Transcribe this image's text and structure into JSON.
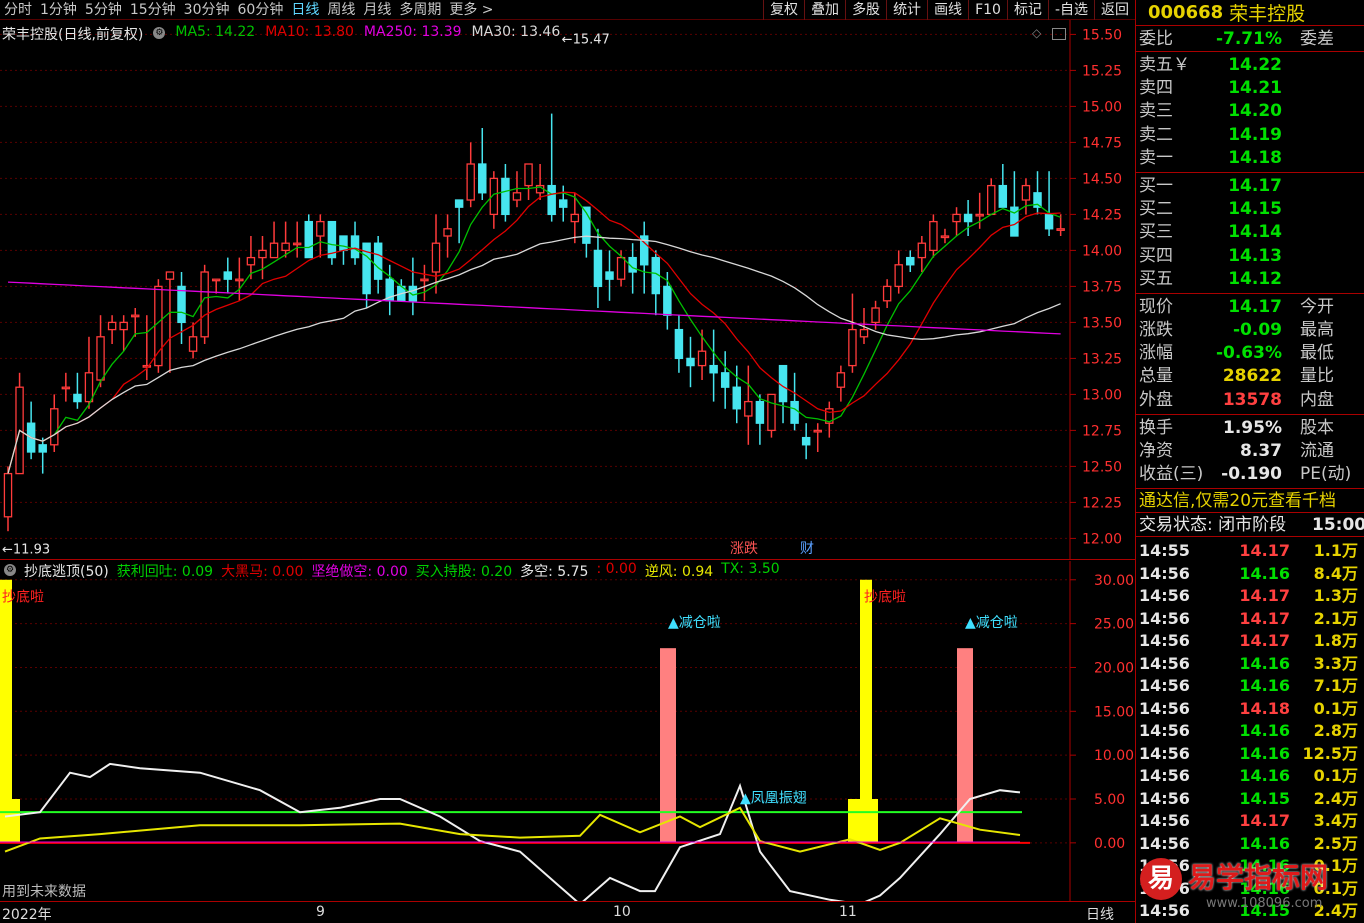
{
  "toolbar": {
    "periods": [
      "分时",
      "1分钟",
      "5分钟",
      "15分钟",
      "30分钟",
      "60分钟",
      "日线",
      "周线",
      "月线",
      "多周期",
      "更多 >"
    ],
    "active_period": "日线",
    "buttons": [
      "复权",
      "叠加",
      "多股",
      "统计",
      "画线",
      "F10",
      "标记",
      "-自选",
      "返回"
    ]
  },
  "main": {
    "title": "荣丰控股(日线,前复权)",
    "ma": [
      {
        "label": "MA5: 14.22",
        "color": "#00c000"
      },
      {
        "label": "MA10: 13.80",
        "color": "#e00000"
      },
      {
        "label": "MA250: 13.39",
        "color": "#e000e0"
      },
      {
        "label": "MA30: 13.46",
        "color": "#d8d8d8"
      }
    ],
    "high_label": "15.47",
    "low_label": "11.93",
    "tag_zhangdie": "涨跌",
    "tag_cai": "财"
  },
  "indicator": {
    "name": "抄底逃顶(50)",
    "items": [
      {
        "label": "获利回吐: 0.09",
        "color": "#00d000"
      },
      {
        "label": "大黑马: 0.00",
        "color": "#e00000"
      },
      {
        "label": "坚绝做空: 0.00",
        "color": "#e000e0"
      },
      {
        "label": "买入持股: 0.20",
        "color": "#00d000"
      },
      {
        "label": "多空: 5.75",
        "color": "#e6e6e6"
      },
      {
        "label": ": 0.00",
        "color": "#e00000"
      },
      {
        "label": "逆风: 0.94",
        "color": "#e6e600"
      },
      {
        "label": "TX: 3.50",
        "color": "#00d000"
      }
    ],
    "signal_buy": "抄底啦",
    "signal_sell": "▲减仓啦",
    "signal_phoenix": "▲凤凰振翅",
    "future_note": "用到未来数据"
  },
  "bottom": {
    "year_label": "2022年",
    "months": [
      "9",
      "10",
      "11"
    ],
    "period_label": "日线"
  },
  "quote": {
    "code": "000668",
    "name": "荣丰控股",
    "weibi_label": "委比",
    "weibi_value": "-7.71%",
    "weicha_label": "委差",
    "asks": [
      {
        "label": "卖五￥",
        "price": "14.22"
      },
      {
        "label": "卖四",
        "price": "14.21"
      },
      {
        "label": "卖三",
        "price": "14.20"
      },
      {
        "label": "卖二",
        "price": "14.19"
      },
      {
        "label": "卖一",
        "price": "14.18"
      }
    ],
    "bids": [
      {
        "label": "买一",
        "price": "14.17"
      },
      {
        "label": "买二",
        "price": "14.15"
      },
      {
        "label": "买三",
        "price": "14.14"
      },
      {
        "label": "买四",
        "price": "14.13"
      },
      {
        "label": "买五",
        "price": "14.12"
      }
    ],
    "stats": [
      {
        "label": "现价",
        "value": "14.17",
        "color": "#00e000",
        "label2": "今开"
      },
      {
        "label": "涨跌",
        "value": "-0.09",
        "color": "#00e000",
        "label2": "最高"
      },
      {
        "label": "涨幅",
        "value": "-0.63%",
        "color": "#00e000",
        "label2": "最低"
      },
      {
        "label": "总量",
        "value": "28622",
        "color": "#e6d200",
        "label2": "量比"
      },
      {
        "label": "外盘",
        "value": "13578",
        "color": "#ff4040",
        "label2": "内盘"
      }
    ],
    "stats2": [
      {
        "label": "换手",
        "value": "1.95%",
        "color": "#e6e6e6",
        "label2": "股本"
      },
      {
        "label": "净资",
        "value": "8.37",
        "color": "#e6e6e6",
        "label2": "流通"
      },
      {
        "label": "收益(三)",
        "value": "-0.190",
        "color": "#e6e6e6",
        "label2": "PE(动)"
      }
    ],
    "ad": "通达信,仅需20元查看千档",
    "trade_state": "交易状态: 闭市阶段",
    "trade_time": "15:00:",
    "ticks": [
      {
        "t": "14:55",
        "p": "14.17",
        "v": "1.1万"
      },
      {
        "t": "14:56",
        "p": "14.16",
        "v": "8.4万"
      },
      {
        "t": "14:56",
        "p": "14.17",
        "v": "1.3万"
      },
      {
        "t": "14:56",
        "p": "14.17",
        "v": "2.1万"
      },
      {
        "t": "14:56",
        "p": "14.17",
        "v": "1.8万"
      },
      {
        "t": "14:56",
        "p": "14.16",
        "v": "3.3万"
      },
      {
        "t": "14:56",
        "p": "14.16",
        "v": "7.1万"
      },
      {
        "t": "14:56",
        "p": "14.18",
        "v": "0.1万"
      },
      {
        "t": "14:56",
        "p": "14.16",
        "v": "2.8万"
      },
      {
        "t": "14:56",
        "p": "14.16",
        "v": "12.5万"
      },
      {
        "t": "14:56",
        "p": "14.16",
        "v": "0.1万"
      },
      {
        "t": "14:56",
        "p": "14.15",
        "v": "2.4万"
      },
      {
        "t": "14:56",
        "p": "14.17",
        "v": "3.4万"
      },
      {
        "t": "14:56",
        "p": "14.16",
        "v": "2.5万"
      },
      {
        "t": "14:56",
        "p": "14.16",
        "v": "0.1万"
      },
      {
        "t": "14:56",
        "p": "14.16",
        "v": "0.1万"
      },
      {
        "t": "14:56",
        "p": "14.15",
        "v": "2.4万"
      }
    ],
    "watermark": "易学指标网",
    "watermark_logo": "易",
    "watermark_url": "www.108096.com"
  },
  "chart_data": [
    {
      "type": "candlestick",
      "title": "荣丰控股(日线,前复权)",
      "ylim": [
        11.85,
        15.6
      ],
      "yticks": [
        12.0,
        12.25,
        12.5,
        12.75,
        13.0,
        13.25,
        13.5,
        13.75,
        14.0,
        14.25,
        14.5,
        14.75,
        15.0,
        15.25,
        15.5
      ],
      "ohlc": [
        [
          12.15,
          12.45,
          12.05,
          12.5
        ],
        [
          12.45,
          13.05,
          12.45,
          13.15
        ],
        [
          12.8,
          12.6,
          12.55,
          12.95
        ],
        [
          12.65,
          12.6,
          12.45,
          12.7
        ],
        [
          12.65,
          12.9,
          12.6,
          13.0
        ],
        [
          13.05,
          13.05,
          12.95,
          13.15
        ],
        [
          13.0,
          12.95,
          12.9,
          13.15
        ],
        [
          12.95,
          13.15,
          12.9,
          13.4
        ],
        [
          13.1,
          13.4,
          13.05,
          13.55
        ],
        [
          13.45,
          13.5,
          13.35,
          13.55
        ],
        [
          13.45,
          13.5,
          13.3,
          13.55
        ],
        [
          13.55,
          13.55,
          13.4,
          13.6
        ],
        [
          13.2,
          13.2,
          13.1,
          13.55
        ],
        [
          13.2,
          13.75,
          13.15,
          13.8
        ],
        [
          13.8,
          13.85,
          13.15,
          13.85
        ],
        [
          13.75,
          13.5,
          13.35,
          13.85
        ],
        [
          13.3,
          13.4,
          13.25,
          13.5
        ],
        [
          13.4,
          13.85,
          13.35,
          13.9
        ],
        [
          13.8,
          13.8,
          13.7,
          13.8
        ],
        [
          13.85,
          13.8,
          13.7,
          13.95
        ],
        [
          13.8,
          13.8,
          13.65,
          13.95
        ],
        [
          13.9,
          13.95,
          13.8,
          14.1
        ],
        [
          13.95,
          14.0,
          13.8,
          14.1
        ],
        [
          13.95,
          14.05,
          13.95,
          14.2
        ],
        [
          14.0,
          14.05,
          13.95,
          14.2
        ],
        [
          14.05,
          14.05,
          13.95,
          14.2
        ],
        [
          14.2,
          13.95,
          13.95,
          14.25
        ],
        [
          14.1,
          14.2,
          13.95,
          14.25
        ],
        [
          14.2,
          13.95,
          13.9,
          14.2
        ],
        [
          14.1,
          14.0,
          13.9,
          14.1
        ],
        [
          14.1,
          13.95,
          13.9,
          14.2
        ],
        [
          14.05,
          13.7,
          13.6,
          14.05
        ],
        [
          14.05,
          13.8,
          13.7,
          14.1
        ],
        [
          13.8,
          13.65,
          13.55,
          13.9
        ],
        [
          13.75,
          13.65,
          13.65,
          13.8
        ],
        [
          13.75,
          13.65,
          13.55,
          13.95
        ],
        [
          13.8,
          13.8,
          13.65,
          13.9
        ],
        [
          13.85,
          14.05,
          13.7,
          14.25
        ],
        [
          14.1,
          14.15,
          13.95,
          14.25
        ],
        [
          14.35,
          14.3,
          14.05,
          14.35
        ],
        [
          14.35,
          14.6,
          14.3,
          14.75
        ],
        [
          14.6,
          14.4,
          14.35,
          14.85
        ],
        [
          14.25,
          14.5,
          14.15,
          14.55
        ],
        [
          14.5,
          14.25,
          14.2,
          14.6
        ],
        [
          14.35,
          14.4,
          14.3,
          14.55
        ],
        [
          14.45,
          14.6,
          14.35,
          14.6
        ],
        [
          14.4,
          14.45,
          14.35,
          14.6
        ],
        [
          14.45,
          14.25,
          14.2,
          14.95
        ],
        [
          14.35,
          14.3,
          14.2,
          14.45
        ],
        [
          14.2,
          14.25,
          14.05,
          14.4
        ],
        [
          14.3,
          14.05,
          13.95,
          14.3
        ],
        [
          14.0,
          13.75,
          13.6,
          14.15
        ],
        [
          13.85,
          13.8,
          13.65,
          14.0
        ],
        [
          13.8,
          13.95,
          13.75,
          14.0
        ],
        [
          13.95,
          13.85,
          13.7,
          14.05
        ],
        [
          14.1,
          13.9,
          13.7,
          14.2
        ],
        [
          13.95,
          13.7,
          13.55,
          14.0
        ],
        [
          13.75,
          13.55,
          13.45,
          13.85
        ],
        [
          13.45,
          13.25,
          13.15,
          13.55
        ],
        [
          13.25,
          13.2,
          13.05,
          13.4
        ],
        [
          13.2,
          13.3,
          13.1,
          13.45
        ],
        [
          13.2,
          13.15,
          12.95,
          13.45
        ],
        [
          13.15,
          13.05,
          12.9,
          13.3
        ],
        [
          13.05,
          12.9,
          12.8,
          13.2
        ],
        [
          12.85,
          12.95,
          12.65,
          13.2
        ],
        [
          12.95,
          12.8,
          12.65,
          13.0
        ],
        [
          12.75,
          13.0,
          12.7,
          13.0
        ],
        [
          13.2,
          12.95,
          12.8,
          13.2
        ],
        [
          12.95,
          12.8,
          12.75,
          13.15
        ],
        [
          12.7,
          12.65,
          12.55,
          12.8
        ],
        [
          12.75,
          12.75,
          12.6,
          12.8
        ],
        [
          12.8,
          12.9,
          12.7,
          12.95
        ],
        [
          13.05,
          13.15,
          12.95,
          13.2
        ],
        [
          13.2,
          13.45,
          13.15,
          13.7
        ],
        [
          13.4,
          13.45,
          13.35,
          13.6
        ],
        [
          13.5,
          13.6,
          13.45,
          13.65
        ],
        [
          13.65,
          13.75,
          13.6,
          13.8
        ],
        [
          13.75,
          13.9,
          13.7,
          14.0
        ],
        [
          13.95,
          13.9,
          13.85,
          14.0
        ],
        [
          13.95,
          14.05,
          13.85,
          14.1
        ],
        [
          14.0,
          14.2,
          13.95,
          14.25
        ],
        [
          14.1,
          14.1,
          14.05,
          14.15
        ],
        [
          14.2,
          14.25,
          14.1,
          14.3
        ],
        [
          14.25,
          14.2,
          14.1,
          14.35
        ],
        [
          14.25,
          14.25,
          14.15,
          14.4
        ],
        [
          14.25,
          14.45,
          14.25,
          14.5
        ],
        [
          14.45,
          14.3,
          14.3,
          14.6
        ],
        [
          14.3,
          14.1,
          14.1,
          14.55
        ],
        [
          14.35,
          14.45,
          14.25,
          14.5
        ],
        [
          14.4,
          14.3,
          14.25,
          14.55
        ],
        [
          14.25,
          14.15,
          14.1,
          14.55
        ],
        [
          14.15,
          14.15,
          14.1,
          14.25
        ]
      ]
    },
    {
      "type": "bar+line",
      "title": "抄底逃顶(50)",
      "ylim": [
        -1.5,
        31
      ],
      "yticks": [
        0.0,
        5.0,
        10.0,
        15.0,
        20.0,
        25.0,
        30.0
      ]
    }
  ]
}
